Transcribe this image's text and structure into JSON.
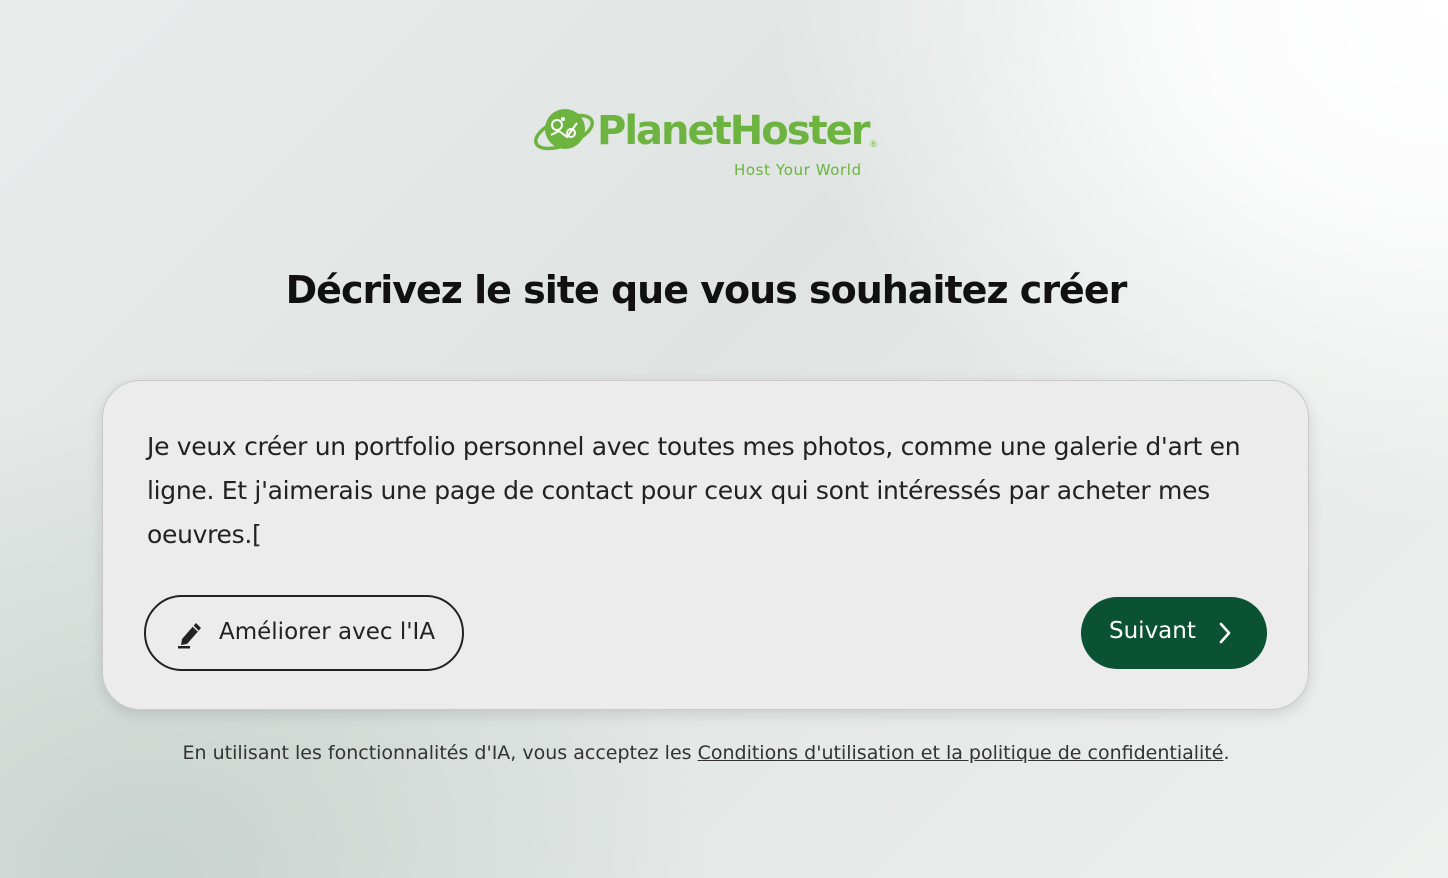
{
  "brand": {
    "name": "PlanetHoster",
    "registered_mark": "®",
    "tagline": "Host Your World",
    "color": "#6db33f"
  },
  "page": {
    "title": "Décrivez le site que vous souhaitez créer"
  },
  "prompt": {
    "text": "Je veux créer un portfolio personnel avec toutes mes photos, comme une galerie d'art en ligne. Et j'aimerais une page de contact pour ceux qui sont intéressés par acheter mes oeuvres.["
  },
  "actions": {
    "improve_label": "Améliorer avec l'IA",
    "improve_icon": "pencil-icon",
    "next_label": "Suivant",
    "next_icon": "chevron-right-icon",
    "next_color": "#0b5234"
  },
  "footer": {
    "disclaimer_prefix": "En utilisant les fonctionnalités d'IA, vous acceptez les ",
    "terms_link": "Conditions d'utilisation et la politique de confidentialité",
    "disclaimer_suffix": "."
  }
}
